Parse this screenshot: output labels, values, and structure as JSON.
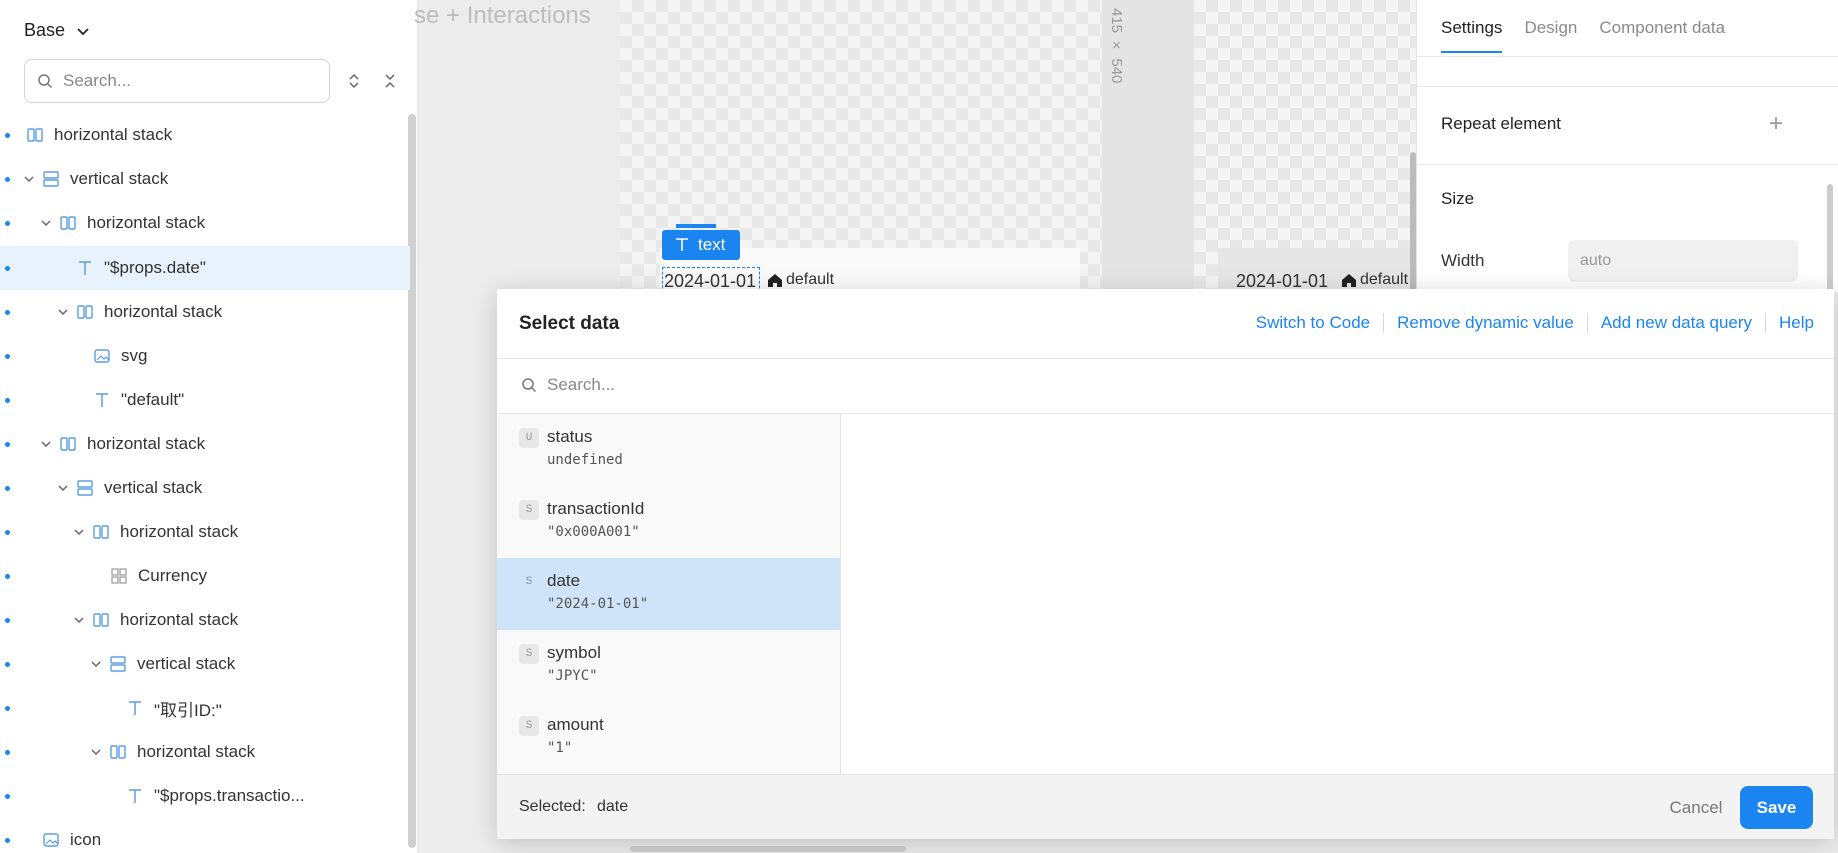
{
  "tree": {
    "base_label": "Base",
    "search_placeholder": "Search...",
    "items": [
      {
        "label": "horizontal stack"
      },
      {
        "label": "vertical stack"
      },
      {
        "label": "horizontal stack"
      },
      {
        "label": "\"$props.date\""
      },
      {
        "label": "horizontal stack"
      },
      {
        "label": "svg"
      },
      {
        "label": "\"default\""
      },
      {
        "label": "horizontal stack"
      },
      {
        "label": "vertical stack"
      },
      {
        "label": "horizontal stack"
      },
      {
        "label": "Currency"
      },
      {
        "label": "horizontal stack"
      },
      {
        "label": "vertical stack"
      },
      {
        "label": "\"取引ID:\""
      },
      {
        "label": "horizontal stack"
      },
      {
        "label": "\"$props.transactio..."
      },
      {
        "label": "icon"
      }
    ]
  },
  "canvas": {
    "title": "se + Interactions",
    "dimensions": "415 × 540",
    "badge_label": "text",
    "date_text": "2024-01-01",
    "default_text": "default"
  },
  "settings": {
    "tabs": [
      "Settings",
      "Design",
      "Component data"
    ],
    "repeat_label": "Repeat element",
    "size_label": "Size",
    "width_label": "Width",
    "width_value": "auto"
  },
  "modal": {
    "title": "Select data",
    "actions": [
      "Switch to Code",
      "Remove dynamic value",
      "Add new data query",
      "Help"
    ],
    "search_placeholder": "Search...",
    "items": [
      {
        "type": "U",
        "name": "status",
        "value": "undefined"
      },
      {
        "type": "S",
        "name": "transactionId",
        "value": "\"0x000A001\""
      },
      {
        "type": "S",
        "name": "date",
        "value": "\"2024-01-01\""
      },
      {
        "type": "S",
        "name": "symbol",
        "value": "\"JPYC\""
      },
      {
        "type": "S",
        "name": "amount",
        "value": "\"1\""
      }
    ],
    "selected_label": "Selected:",
    "selected_value": "date",
    "cancel_label": "Cancel",
    "save_label": "Save"
  },
  "colors": {
    "accent": "#1a85f0",
    "selected_row": "#e8f2fd",
    "selected_item": "#cfe4f9"
  }
}
